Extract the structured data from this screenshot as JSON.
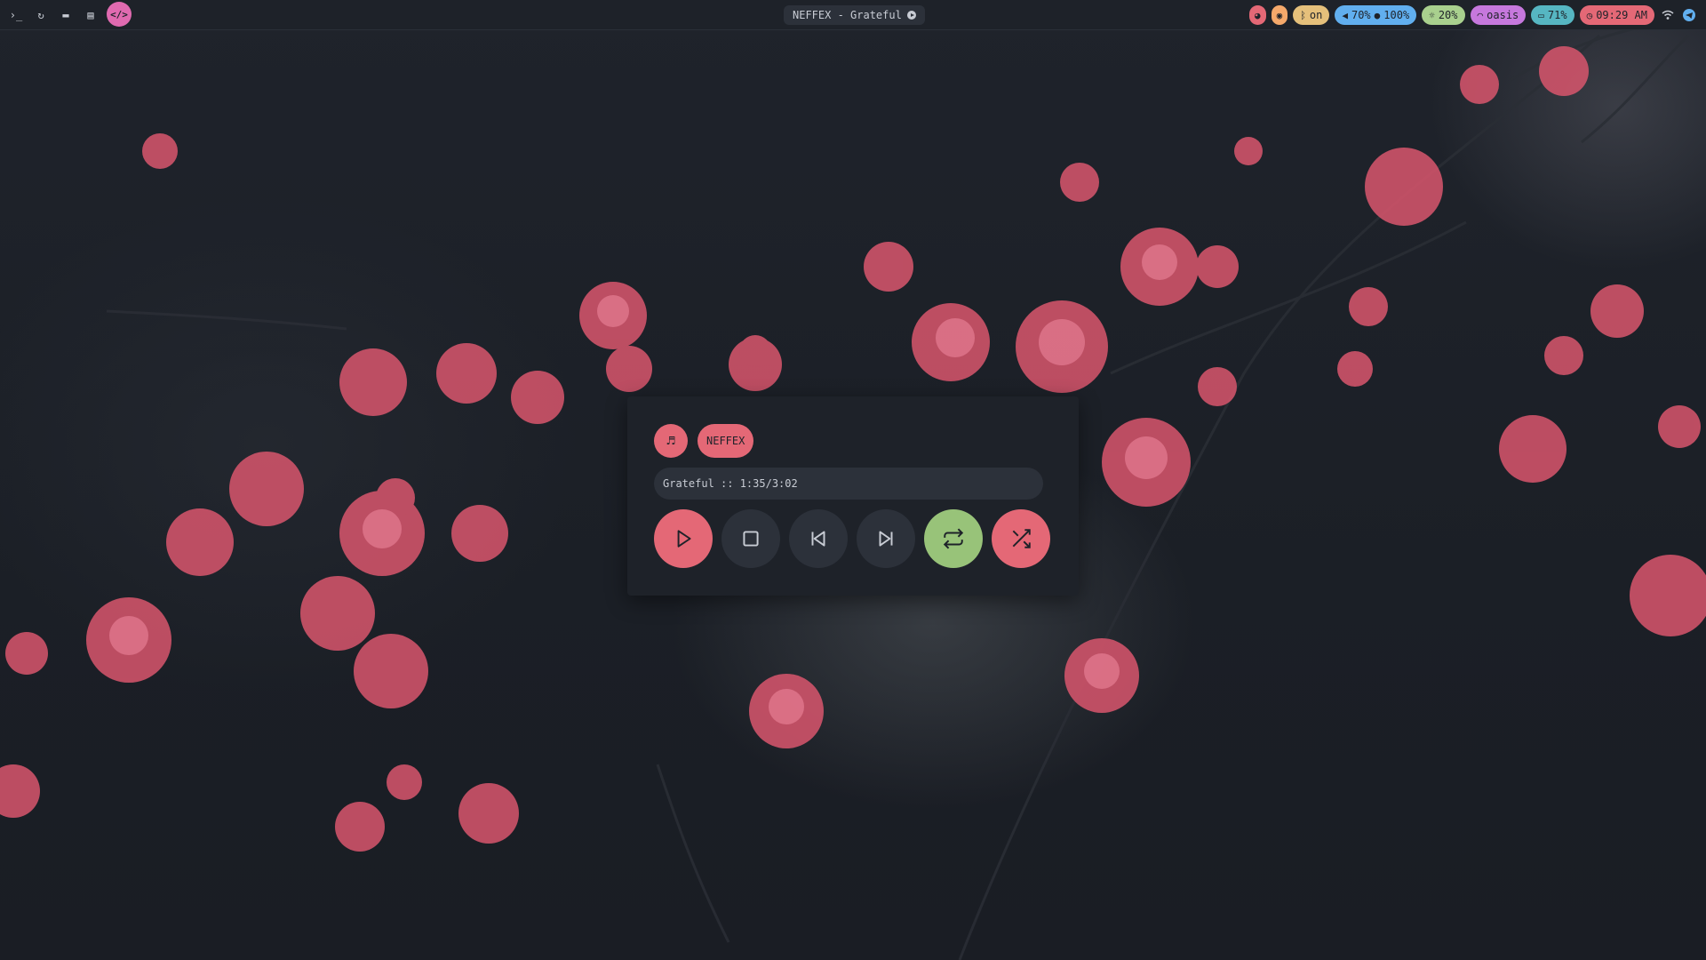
{
  "topbar": {
    "left_icons": [
      {
        "icon": "terminal-icon",
        "glyph": "›_"
      },
      {
        "icon": "refresh-icon",
        "glyph": "↻"
      },
      {
        "icon": "folder-icon",
        "glyph": "▬"
      },
      {
        "icon": "document-icon",
        "glyph": "▤"
      },
      {
        "icon": "code-icon",
        "glyph": "</>",
        "active": true
      }
    ],
    "now_playing": "NEFFEX - Grateful",
    "status": {
      "bluetooth": "on",
      "volume": "70%",
      "mic": "100%",
      "brightness": "20%",
      "wifi": "oasis",
      "battery": "71%",
      "clock": "09:29 AM"
    },
    "colors": {
      "palette": "#e46876",
      "eye": "#f5a96b",
      "bluetooth": "#e5c07b",
      "audio": "#61afef",
      "brightness": "#a9d08e",
      "wifi": "#c678dd",
      "battery": "#56b6c2",
      "clock": "#e46876"
    }
  },
  "player": {
    "artist": "NEFFEX",
    "track_line": "Grateful :: 1:35/3:02",
    "controls": [
      "play",
      "stop",
      "previous",
      "next",
      "repeat",
      "shuffle"
    ],
    "colors": {
      "accent": "#e46876",
      "repeat_active": "#98c379",
      "neutral": "#2c313a"
    }
  }
}
